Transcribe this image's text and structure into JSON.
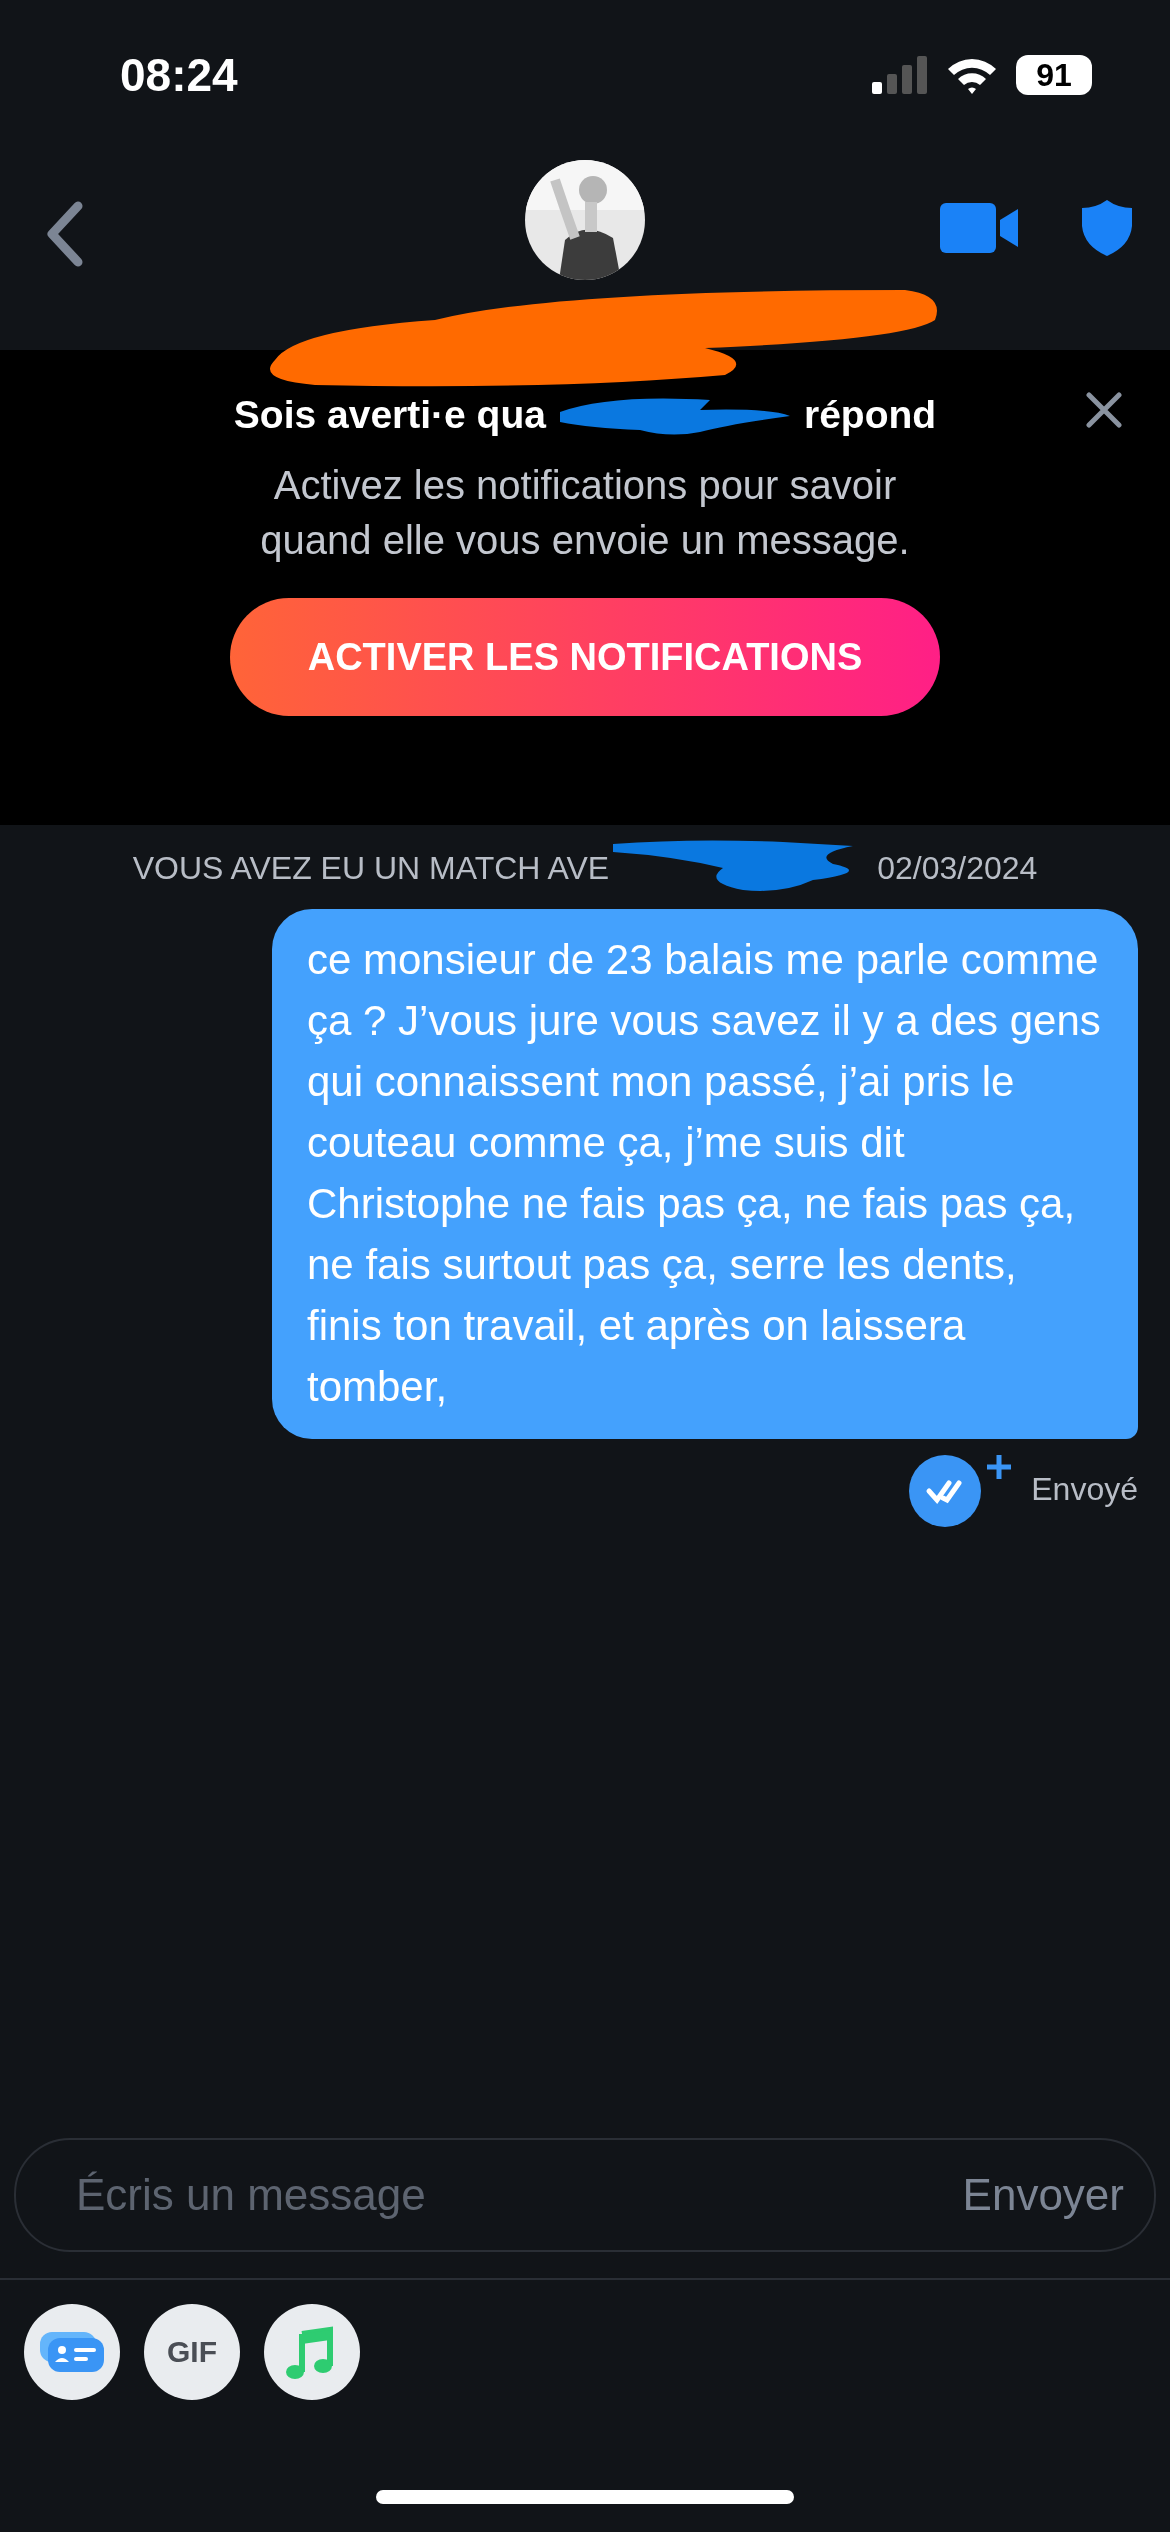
{
  "status_bar": {
    "time": "08:24",
    "battery": "91"
  },
  "banner": {
    "title_start": "Sois averti·e qua",
    "title_end": "répond",
    "body": "Activez les notifications pour savoir quand elle vous envoie un message.",
    "button": "ACTIVER LES NOTIFICATIONS"
  },
  "match_notice": {
    "start": "VOUS AVEZ EU UN MATCH AVE",
    "end": "02/03/2024"
  },
  "messages": [
    {
      "kind": "sent",
      "text": "ce monsieur de 23 balais me parle comme ça ? J’vous jure vous savez il y a des gens qui connaissent mon passé, j’ai pris le couteau comme ça, j’me suis dit Christophe ne fais pas ça, ne fais pas ça, ne fais surtout pas ça, serre les dents, finis ton travail, et après on laissera tomber,",
      "status": "Envoyé"
    }
  ],
  "composer": {
    "placeholder": "Écris un message",
    "send": "Envoyer"
  },
  "toolbar": [
    {
      "kind": "card"
    },
    {
      "kind": "gif",
      "label": "GIF"
    },
    {
      "kind": "music"
    }
  ]
}
